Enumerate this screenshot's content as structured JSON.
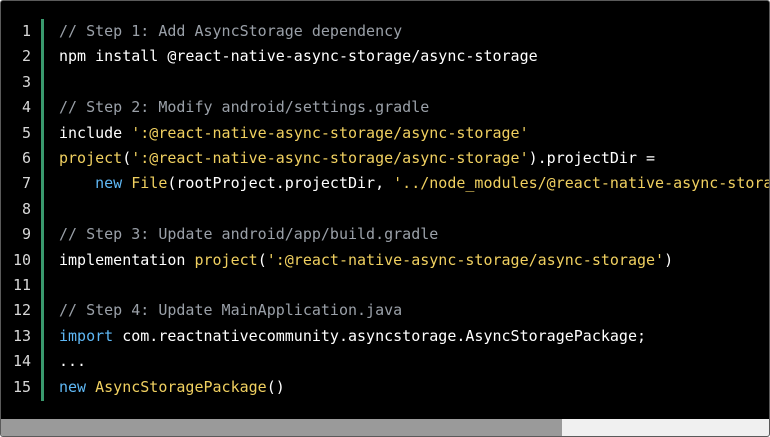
{
  "editor": {
    "lines": [
      {
        "num": "1",
        "tokens": [
          {
            "t": "comment",
            "v": "// Step 1: Add AsyncStorage dependency"
          }
        ]
      },
      {
        "num": "2",
        "tokens": [
          {
            "t": "plain",
            "v": "npm install @react-native-async-storage/async-storage"
          }
        ]
      },
      {
        "num": "3",
        "tokens": []
      },
      {
        "num": "4",
        "tokens": [
          {
            "t": "comment",
            "v": "// Step 2: Modify android/settings.gradle"
          }
        ]
      },
      {
        "num": "5",
        "tokens": [
          {
            "t": "plain",
            "v": "include "
          },
          {
            "t": "string",
            "v": "':@react-native-async-storage/async-storage'"
          }
        ]
      },
      {
        "num": "6",
        "tokens": [
          {
            "t": "fn",
            "v": "project"
          },
          {
            "t": "plain",
            "v": "("
          },
          {
            "t": "string",
            "v": "':@react-native-async-storage/async-storage'"
          },
          {
            "t": "plain",
            "v": ").projectDir ="
          }
        ]
      },
      {
        "num": "7",
        "tokens": [
          {
            "t": "plain",
            "v": "    "
          },
          {
            "t": "keyword",
            "v": "new"
          },
          {
            "t": "plain",
            "v": " "
          },
          {
            "t": "fn",
            "v": "File"
          },
          {
            "t": "plain",
            "v": "(rootProject.projectDir, "
          },
          {
            "t": "string",
            "v": "'../node_modules/@react-native-async-storage/async-storage/android'"
          },
          {
            "t": "plain",
            "v": ")"
          }
        ]
      },
      {
        "num": "8",
        "tokens": []
      },
      {
        "num": "9",
        "tokens": [
          {
            "t": "comment",
            "v": "// Step 3: Update android/app/build.gradle"
          }
        ]
      },
      {
        "num": "10",
        "tokens": [
          {
            "t": "plain",
            "v": "implementation "
          },
          {
            "t": "fn",
            "v": "project"
          },
          {
            "t": "plain",
            "v": "("
          },
          {
            "t": "string",
            "v": "':@react-native-async-storage/async-storage'"
          },
          {
            "t": "plain",
            "v": ")"
          }
        ]
      },
      {
        "num": "11",
        "tokens": []
      },
      {
        "num": "12",
        "tokens": [
          {
            "t": "comment",
            "v": "// Step 4: Update MainApplication.java"
          }
        ]
      },
      {
        "num": "13",
        "tokens": [
          {
            "t": "keyword",
            "v": "import"
          },
          {
            "t": "plain",
            "v": " com.reactnativecommunity.asyncstorage.AsyncStoragePackage;"
          }
        ]
      },
      {
        "num": "14",
        "tokens": [
          {
            "t": "plain",
            "v": "..."
          }
        ]
      },
      {
        "num": "15",
        "tokens": [
          {
            "t": "keyword",
            "v": "new"
          },
          {
            "t": "plain",
            "v": " "
          },
          {
            "t": "fn",
            "v": "AsyncStoragePackage"
          },
          {
            "t": "plain",
            "v": "()"
          }
        ]
      }
    ]
  },
  "colors": {
    "background": "#000000",
    "comment": "#9aa0a8",
    "keyword": "#5fb8f5",
    "string": "#f0d060",
    "gutter_accent": "#3a9a6e"
  },
  "scroll": {
    "horizontal_position_fraction": 0.0,
    "visible_fraction": 0.73
  }
}
